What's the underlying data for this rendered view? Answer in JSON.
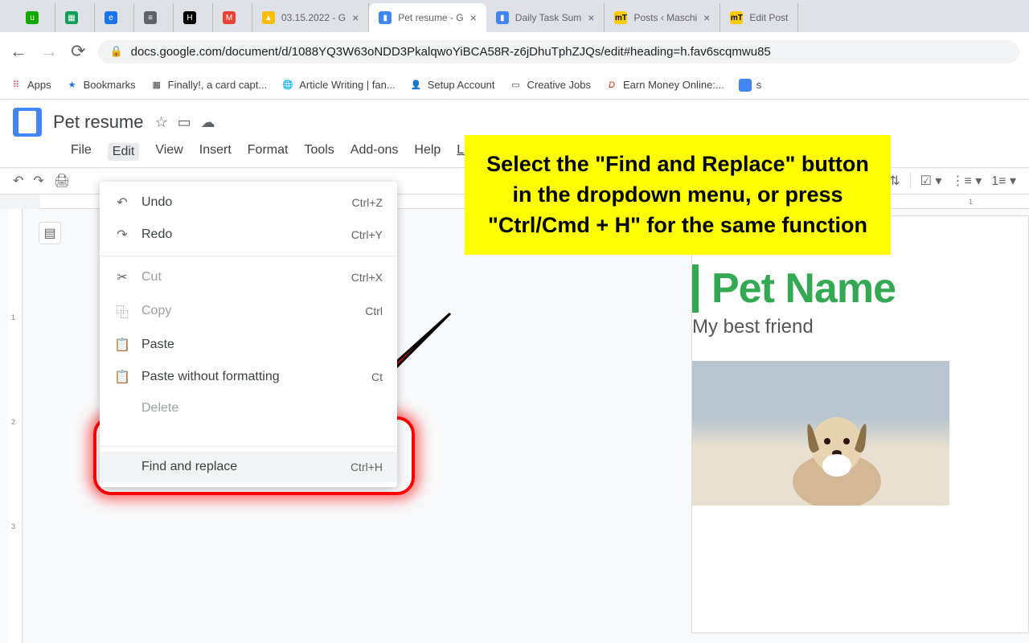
{
  "tabs": [
    {
      "icon_bg": "#14a800",
      "label": ""
    },
    {
      "icon_bg": "#0f9d58",
      "label": ""
    },
    {
      "icon_bg": "#1a73e8",
      "label": ""
    },
    {
      "icon_bg": "#5f6368",
      "label": ""
    },
    {
      "icon_bg": "#000",
      "label": ""
    },
    {
      "icon_bg": "#ea4335",
      "label": ""
    },
    {
      "icon_bg": "#fbbc04",
      "label": "03.15.2022 - G"
    },
    {
      "icon_bg": "#4285f4",
      "label": "Pet resume - G",
      "active": true
    },
    {
      "icon_bg": "#4285f4",
      "label": "Daily Task Sum"
    },
    {
      "icon_bg": "#ffcc00",
      "label": "Posts ‹ Maschi"
    },
    {
      "icon_bg": "#ffcc00",
      "label": "Edit Post"
    }
  ],
  "url": "docs.google.com/document/d/1088YQ3W63oNDD3PkalqwoYiBCA58R-z6jDhuTphZJQs/edit#heading=h.fav6scqmwu85",
  "bookmarks": [
    {
      "label": "Apps"
    },
    {
      "label": "Bookmarks"
    },
    {
      "label": "Finally!, a card capt..."
    },
    {
      "label": "Article Writing | fan..."
    },
    {
      "label": "Setup Account"
    },
    {
      "label": "Creative Jobs"
    },
    {
      "label": "Earn Money Online:..."
    },
    {
      "label": "s"
    }
  ],
  "doc_title": "Pet resume",
  "menus": {
    "file": "File",
    "edit": "Edit",
    "view": "View",
    "insert": "Insert",
    "format": "Format",
    "tools": "Tools",
    "addons": "Add-ons",
    "help": "Help",
    "last_edit": "Last"
  },
  "edit_menu": {
    "undo": {
      "label": "Undo",
      "shortcut": "Ctrl+Z"
    },
    "redo": {
      "label": "Redo",
      "shortcut": "Ctrl+Y"
    },
    "cut": {
      "label": "Cut",
      "shortcut": "Ctrl+X"
    },
    "copy": {
      "label": "Copy",
      "shortcut": "Ctrl"
    },
    "paste": {
      "label": "Paste"
    },
    "paste_wf": {
      "label": "Paste without formatting",
      "shortcut": "Ct"
    },
    "delete": {
      "label": "Delete"
    },
    "find_replace": {
      "label": "Find and replace",
      "shortcut": "Ctrl+H"
    }
  },
  "callout_text": "Select the \"Find and Replace\" button in the dropdown menu, or press \"Ctrl/Cmd + H\" for the same function",
  "page_content": {
    "heading": "Pet Name",
    "sub": "My best friend"
  },
  "ruler": {
    "marks": [
      "1"
    ]
  },
  "vruler": {
    "marks": [
      "1",
      "2",
      "3"
    ]
  }
}
